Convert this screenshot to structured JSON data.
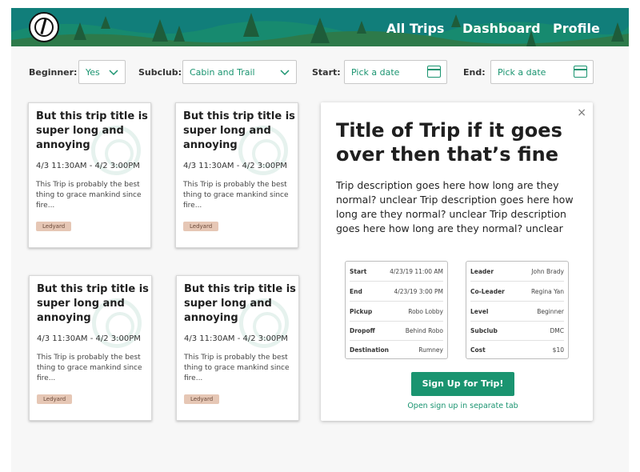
{
  "header": {
    "nav": [
      "All Trips",
      "Dashboard",
      "Profile"
    ],
    "colors": {
      "header_bg": "#117e7a",
      "accent": "#1a9470"
    }
  },
  "filters": {
    "beginner_label": "Beginner:",
    "beginner_value": "Yes",
    "subclub_label": "Subclub:",
    "subclub_value": "Cabin and Trail",
    "start_label": "Start:",
    "start_placeholder": "Pick a date",
    "end_label": "End:",
    "end_placeholder": "Pick a date"
  },
  "cards": [
    {
      "title": "But this trip title is super long and annoying",
      "date": "4/3 11:30AM - 4/2 3:00PM",
      "desc": "This Trip is probably the best thing to grace mankind since fire...",
      "tag": "Ledyard"
    },
    {
      "title": "But this trip title is super long and annoying",
      "date": "4/3 11:30AM - 4/2 3:00PM",
      "desc": "This Trip is probably the best thing to grace mankind since fire...",
      "tag": "Ledyard"
    },
    {
      "title": "But this trip title is super long and annoying",
      "date": "4/3 11:30AM - 4/2 3:00PM",
      "desc": "This Trip is probably the best thing to grace mankind since fire...",
      "tag": "Ledyard"
    },
    {
      "title": "But this trip title is super long and annoying",
      "date": "4/3 11:30AM - 4/2 3:00PM",
      "desc": "This Trip is probably the best thing to grace mankind since fire...",
      "tag": "Ledyard"
    }
  ],
  "detail": {
    "close": "×",
    "title": "Title of Trip if it goes over then that’s fine",
    "description": "Trip description goes here how long are they normal? unclear Trip description goes here how long are they normal? unclear Trip description goes here how long are they normal? unclear",
    "left_table": [
      {
        "key": "Start",
        "value": "4/23/19 11:00 AM"
      },
      {
        "key": "End",
        "value": "4/23/19 3:00 PM"
      },
      {
        "key": "Pickup",
        "value": "Robo Lobby"
      },
      {
        "key": "Dropoff",
        "value": "Behind Robo"
      },
      {
        "key": "Destination",
        "value": "Rumney"
      }
    ],
    "right_table": [
      {
        "key": "Leader",
        "value": "John Brady"
      },
      {
        "key": "Co-Leader",
        "value": "Regina Yan"
      },
      {
        "key": "Level",
        "value": "Beginner"
      },
      {
        "key": "Subclub",
        "value": "DMC"
      },
      {
        "key": "Cost",
        "value": "$10"
      }
    ],
    "signup_button": "Sign Up for Trip!",
    "signup_link": "Open sign up in separate tab"
  }
}
